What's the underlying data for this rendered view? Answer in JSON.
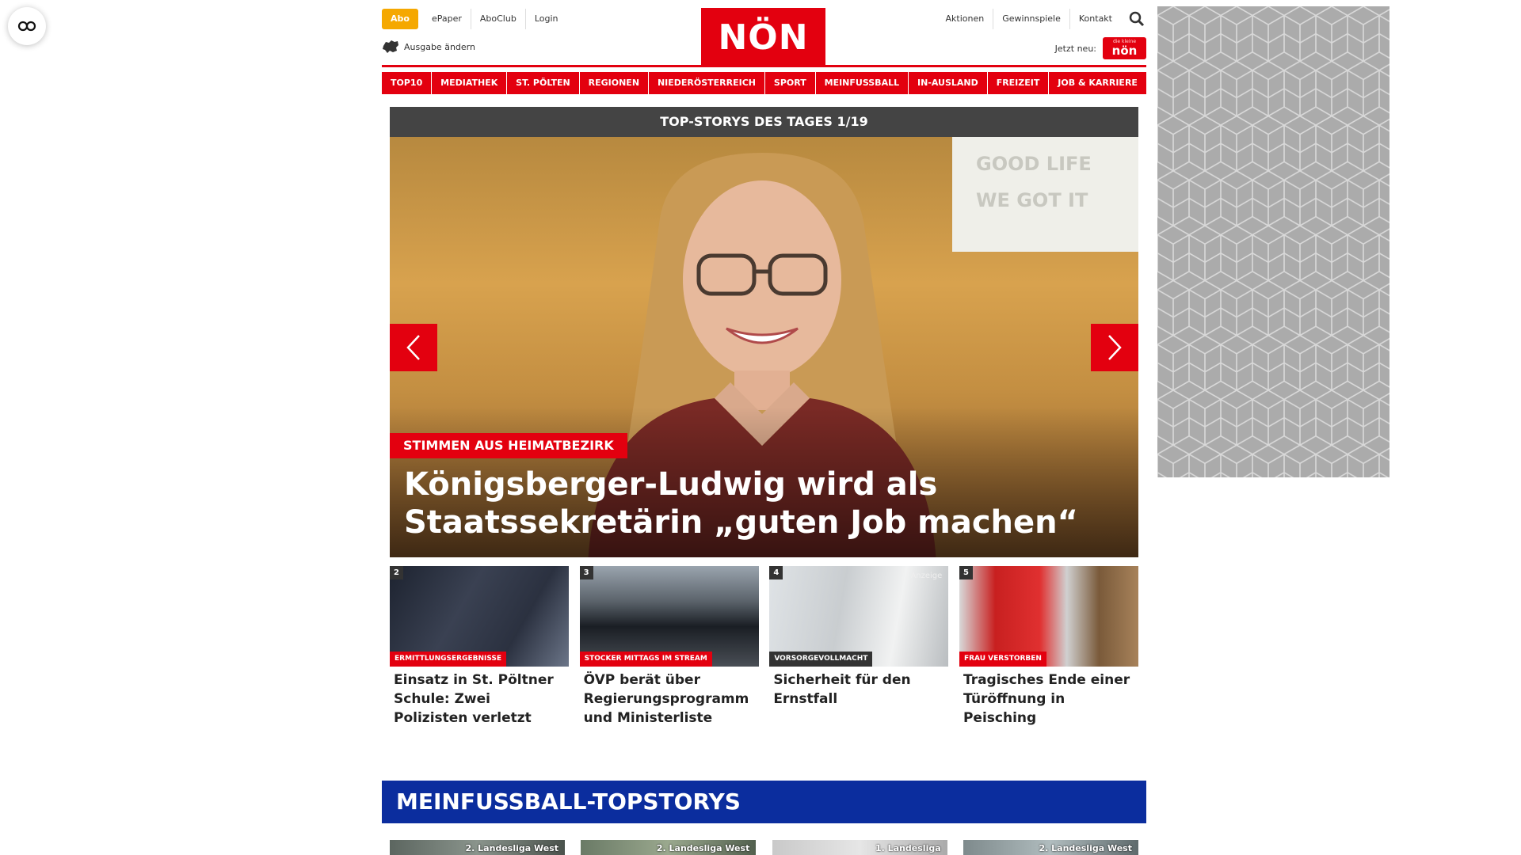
{
  "reader": {
    "icon": "glasses-icon"
  },
  "utility": {
    "abo": "Abo",
    "left_links": [
      "ePaper",
      "AboClub",
      "Login"
    ],
    "ausgabe": "Ausgabe ändern",
    "right_links": [
      "Aktionen",
      "Gewinnspiele",
      "Kontakt"
    ],
    "jetzt": "Jetzt neu:",
    "mini_logo_small": "die kleine",
    "mini_logo": "nön"
  },
  "logo": "NÖN",
  "nav": [
    "TOP10",
    "MEDIATHEK",
    "ST. PÖLTEN",
    "REGIONEN",
    "NIEDERÖSTERREICH",
    "SPORT",
    "MEINFUSSBALL",
    "IN-AUSLAND",
    "FREIZEIT",
    "JOB & KARRIERE"
  ],
  "topstory": {
    "bar": "TOP-STORYS DES TAGES 1/19",
    "sign_lines": [
      "GOOD LIFE",
      "WE GOT IT"
    ],
    "kicker": "STIMMEN AUS HEIMATBEZIRK",
    "headline": "Königsberger-Ludwig wird als Staatssekretärin „guten Job machen“"
  },
  "stories": [
    {
      "num": "2",
      "badge": "ERMITTLUNGSERGEBNISSE",
      "title": "Einsatz in St. Pöltner Schule: Zwei Polizisten verletzt"
    },
    {
      "num": "3",
      "badge": "STOCKER MITTAGS IM STREAM",
      "title": "ÖVP berät über Regierungsprogramm und Ministerliste"
    },
    {
      "num": "4",
      "badge": "VORSORGEVOLLMACHT",
      "anzeige": "Anzeige",
      "title": "Sicherheit für den Ernstfall"
    },
    {
      "num": "5",
      "badge": "FRAU VERSTORBEN",
      "title": "Tragisches Ende einer Türöffnung in Peisching"
    }
  ],
  "meinfussball": {
    "title": "MEINFUSSBALL-TOPSTORYS",
    "tags": [
      "2. Landesliga West",
      "2. Landesliga West",
      "1. Landesliga",
      "2. Landesliga West"
    ]
  },
  "colors": {
    "brand_red": "#e3000f",
    "abo_orange": "#f5a800",
    "mf_blue": "#0b2d9e"
  }
}
